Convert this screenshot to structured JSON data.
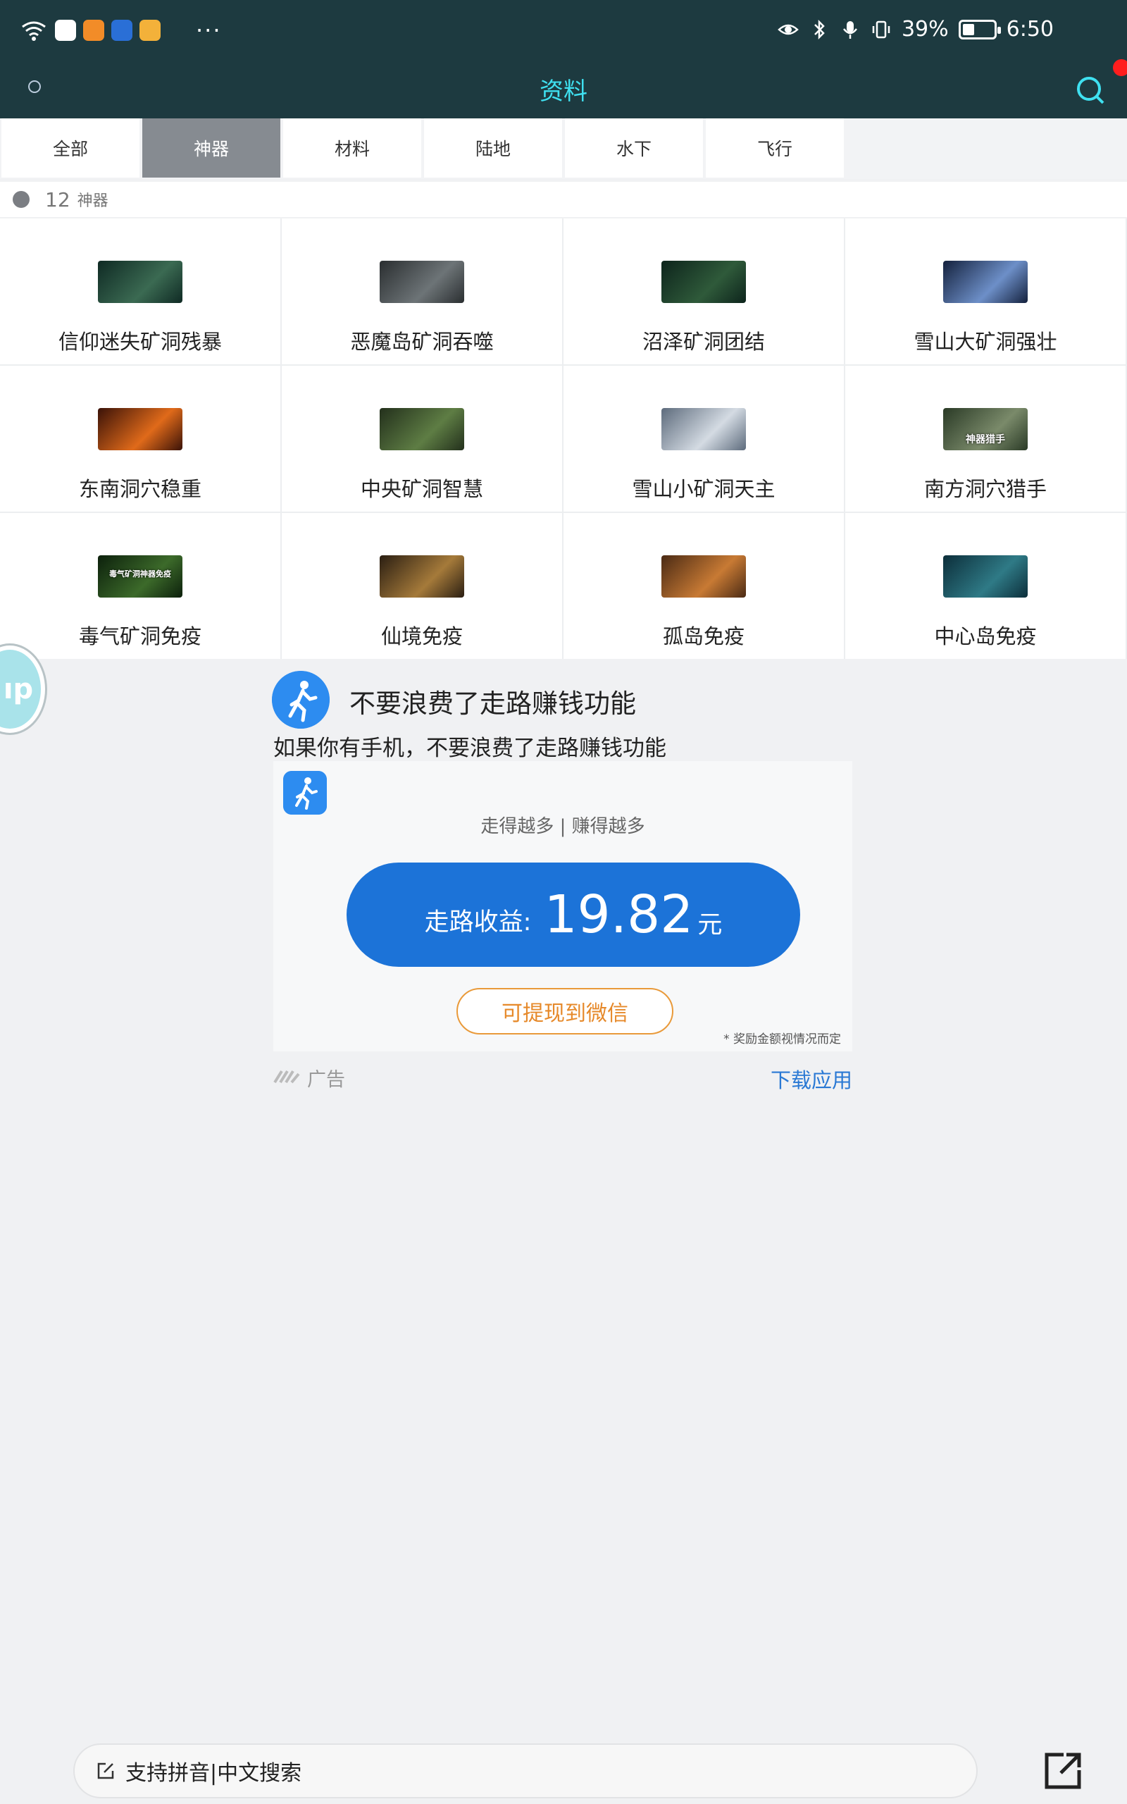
{
  "status_bar": {
    "battery_text": "39%",
    "battery_level": 0.39,
    "time": "6:50",
    "more": "···"
  },
  "header": {
    "title": "资料"
  },
  "tabs": [
    {
      "label": "全部",
      "active": false
    },
    {
      "label": "神器",
      "active": true
    },
    {
      "label": "材料",
      "active": false
    },
    {
      "label": "陆地",
      "active": false
    },
    {
      "label": "水下",
      "active": false
    },
    {
      "label": "飞行",
      "active": false
    }
  ],
  "list_header": {
    "count": "12",
    "label": "神器"
  },
  "items": [
    {
      "label": "信仰迷失矿洞残暴",
      "thumb": [
        "#0f2a24",
        "#3b6a52"
      ]
    },
    {
      "label": "恶魔岛矿洞吞噬",
      "thumb": [
        "#2a2e30",
        "#6d7477"
      ]
    },
    {
      "label": "沼泽矿洞团结",
      "thumb": [
        "#0d241c",
        "#2f5a3a"
      ]
    },
    {
      "label": "雪山大矿洞强壮",
      "thumb": [
        "#14213d",
        "#6d8fc8"
      ]
    },
    {
      "label": "东南洞穴稳重",
      "thumb": [
        "#3a1208",
        "#e06a1a"
      ]
    },
    {
      "label": "中央矿洞智慧",
      "thumb": [
        "#23301c",
        "#5e7d44"
      ]
    },
    {
      "label": "雪山小矿洞天主",
      "thumb": [
        "#5d6b7c",
        "#d4dbe3"
      ]
    },
    {
      "label": "南方洞穴猎手",
      "thumb": [
        "#2a3a26",
        "#7a8a6a"
      ],
      "caption": "神器猎手"
    },
    {
      "label": "毒气矿洞免疫",
      "thumb": [
        "#0c200c",
        "#3c6a2a"
      ],
      "caption": "毒气矿洞神器免疫"
    },
    {
      "label": "仙境免疫",
      "thumb": [
        "#2a1e12",
        "#a57a3a"
      ]
    },
    {
      "label": "孤岛免疫",
      "thumb": [
        "#4a2a14",
        "#c87a34"
      ]
    },
    {
      "label": "中心岛免疫",
      "thumb": [
        "#0c2e3a",
        "#2f7a86"
      ]
    }
  ],
  "ad": {
    "title": "不要浪费了走路赚钱功能",
    "description": "如果你有手机，不要浪费了走路赚钱功能",
    "slogan": "走得越多 | 赚得越多",
    "earnings_label": "走路收益:",
    "earnings_amount": "19.82",
    "earnings_unit": "元",
    "withdraw_label": "可提现到微信",
    "note": "* 奖励金额视情况而定",
    "ad_label": "广告",
    "download_label": "下载应用",
    "accent": "#1c73d8"
  },
  "floating_button": {
    "text": "ıp"
  },
  "bottom": {
    "search_placeholder": "支持拼音|中文搜索"
  }
}
